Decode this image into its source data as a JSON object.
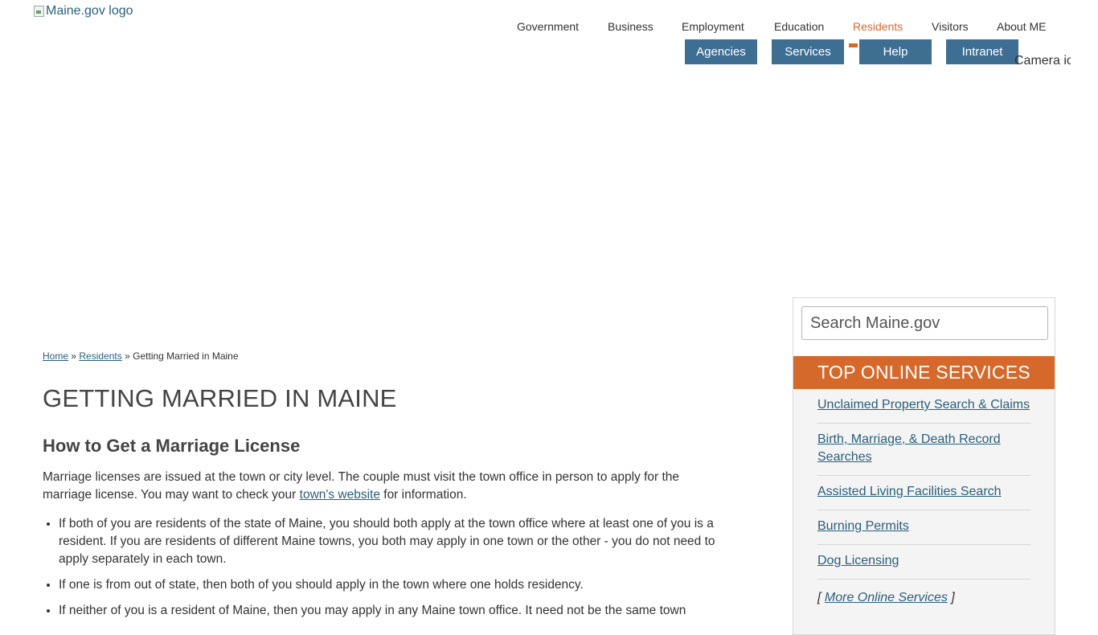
{
  "header": {
    "logo_alt": "Maine.gov logo",
    "camera_alt": "Camera icon"
  },
  "topnav": [
    {
      "label": "Government"
    },
    {
      "label": "Business"
    },
    {
      "label": "Employment"
    },
    {
      "label": "Education"
    },
    {
      "label": "Residents",
      "active": true
    },
    {
      "label": "Visitors"
    },
    {
      "label": "About ME"
    }
  ],
  "subnav": [
    {
      "label": "Agencies"
    },
    {
      "label": "Services"
    },
    {
      "label": "Help"
    },
    {
      "label": "Intranet"
    }
  ],
  "breadcrumb": {
    "home": "Home",
    "sep1": "»",
    "residents": "Residents",
    "sep2": "»",
    "current": "Getting Married in Maine"
  },
  "main": {
    "title": "GETTING MARRIED IN MAINE",
    "section_title": "How to Get a Marriage License",
    "intro_before": "Marriage licenses are issued at the town or city level. The couple must visit the town office in person to apply for the marriage license. You may want to check your ",
    "intro_link": "town's website",
    "intro_after": " for information.",
    "bullets": [
      "If both of you are residents of the state of Maine, you should both apply at the town office where at least one of you is a resident. If you are residents of different Maine towns, you both may apply in one town or the other - you do not need to apply separately in each town.",
      "If one is from out of state, then both of you should apply in the town where one holds residency.",
      "If neither of you is a resident of Maine, then you may apply in any Maine town office. It need not be the same town"
    ]
  },
  "sidebar": {
    "search_placeholder": "Search Maine.gov",
    "header": "TOP ONLINE SERVICES",
    "links": [
      "Unclaimed Property Search & Claims",
      "Birth, Marriage, & Death Record Searches",
      "Assisted Living Facilities Search",
      "Burning Permits",
      "Dog Licensing"
    ],
    "more_open": "[ ",
    "more_label": "More Online Services",
    "more_close": " ]"
  },
  "colors": {
    "accent": "#d5692b",
    "button": "#3f6e93",
    "link": "#2a5f7a"
  }
}
